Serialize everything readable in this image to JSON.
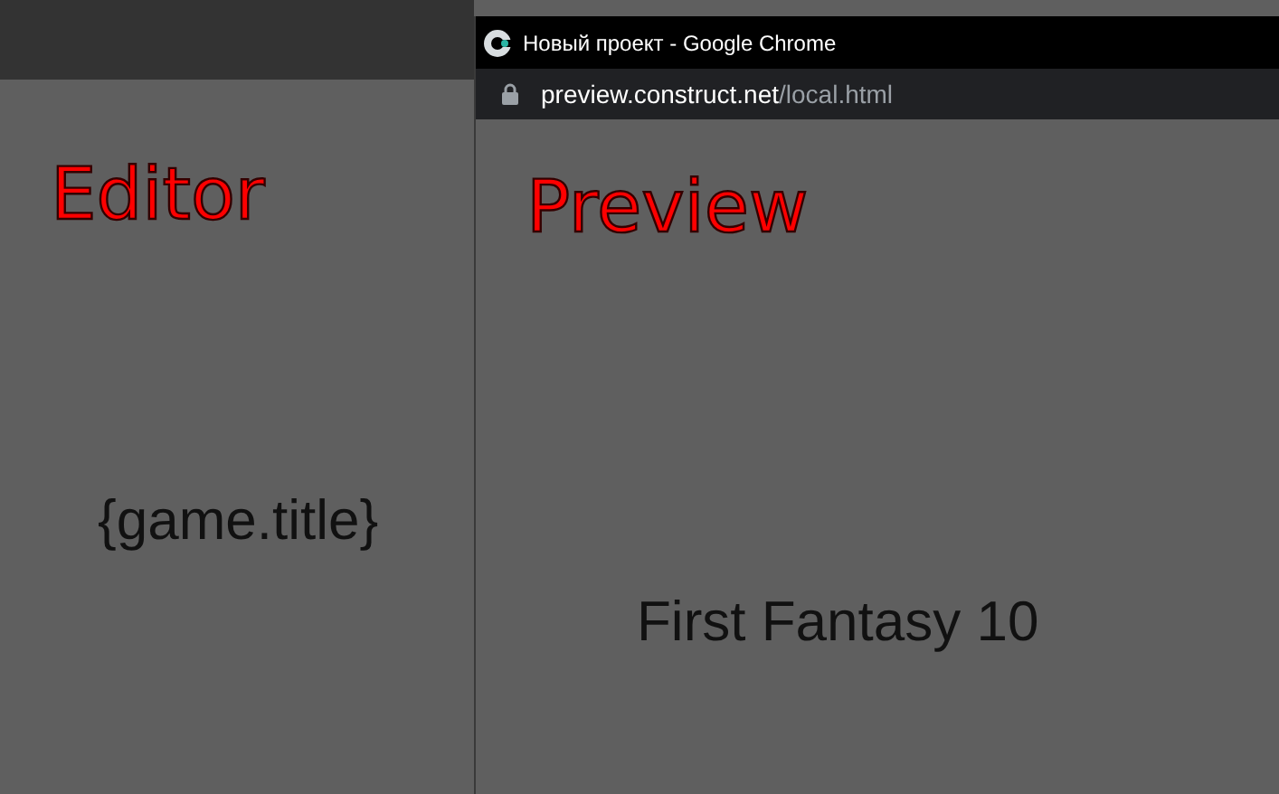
{
  "editor": {
    "label": "Editor",
    "text_object": "{game.title}"
  },
  "browser_window": {
    "title": "Новый проект - Google Chrome",
    "url": {
      "host": "preview.construct.net",
      "path": "/local.html"
    },
    "secure": true
  },
  "preview": {
    "label": "Preview",
    "text_object": "First Fantasy 10"
  }
}
